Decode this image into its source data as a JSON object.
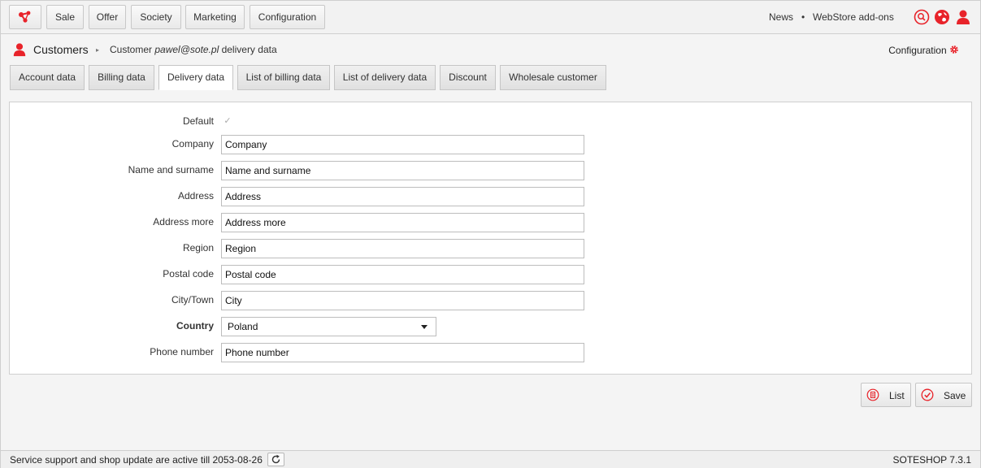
{
  "topnav": {
    "logo_icon": "network-nodes-icon",
    "items": [
      {
        "label": "Sale"
      },
      {
        "label": "Offer"
      },
      {
        "label": "Society"
      },
      {
        "label": "Marketing"
      },
      {
        "label": "Configuration"
      }
    ],
    "news_label": "News",
    "separator": "•",
    "addons_label": "WebStore add-ons",
    "accent_color": "#e8232a"
  },
  "breadcrumb": {
    "title": "Customers",
    "arrow": "▸",
    "sub_prefix": "Customer ",
    "sub_email": "pawel@sote.pl",
    "sub_suffix": " delivery data",
    "config_label": "Configuration"
  },
  "tabs": [
    {
      "label": "Account data",
      "active": false
    },
    {
      "label": "Billing data",
      "active": false
    },
    {
      "label": "Delivery data",
      "active": true
    },
    {
      "label": "List of billing data",
      "active": false
    },
    {
      "label": "List of delivery data",
      "active": false
    },
    {
      "label": "Discount",
      "active": false
    },
    {
      "label": "Wholesale customer",
      "active": false
    }
  ],
  "form": {
    "default_label": "Default",
    "default_checked": true,
    "company_label": "Company",
    "company_value": "Company",
    "name_label": "Name and surname",
    "name_value": "Name and surname",
    "address_label": "Address",
    "address_value": "Address",
    "address_more_label": "Address more",
    "address_more_value": "Address more",
    "region_label": "Region",
    "region_value": "Region",
    "postal_label": "Postal code",
    "postal_value": "Postal code",
    "city_label": "City/Town",
    "city_value": "City",
    "country_label": "Country",
    "country_value": "Poland",
    "phone_label": "Phone number",
    "phone_value": "Phone number"
  },
  "actions": {
    "list_label": "List",
    "save_label": "Save"
  },
  "footer": {
    "status_text": "Service support and shop update are active till 2053-08-26",
    "version": "SOTESHOP 7.3.1"
  }
}
